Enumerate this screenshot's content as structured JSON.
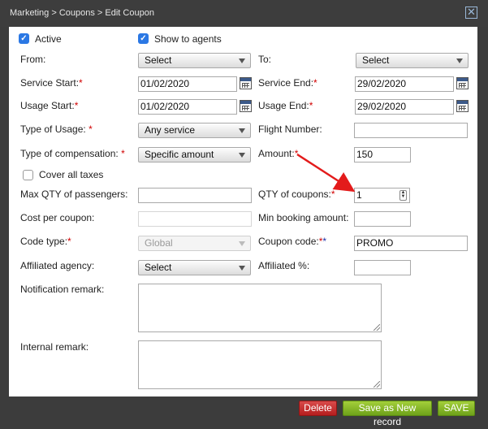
{
  "window": {
    "breadcrumb": "Marketing > Coupons > Edit Coupon",
    "close_glyph": "✕"
  },
  "form": {
    "active": {
      "label": "Active",
      "checked": true
    },
    "show_to_agents": {
      "label": "Show to agents",
      "checked": true
    },
    "from": {
      "label": "From:",
      "value": "Select"
    },
    "to": {
      "label": "To:",
      "value": "Select"
    },
    "service_start": {
      "label": "Service Start:",
      "required": "*",
      "value": "01/02/2020"
    },
    "service_end": {
      "label": "Service End:",
      "required": "*",
      "value": "29/02/2020"
    },
    "usage_start": {
      "label": "Usage Start:",
      "required": "*",
      "value": "01/02/2020"
    },
    "usage_end": {
      "label": "Usage End:",
      "required": "*",
      "value": "29/02/2020"
    },
    "type_of_usage": {
      "label": "Type of Usage:",
      "required": "*",
      "value": "Any service"
    },
    "flight_number": {
      "label": "Flight Number:",
      "value": ""
    },
    "type_of_compensation": {
      "label": "Type of compensation:",
      "required": "*",
      "value": "Specific amount"
    },
    "amount": {
      "label": "Amount:",
      "required": "*",
      "value": "150"
    },
    "cover_all_taxes": {
      "label": "Cover all taxes",
      "checked": false
    },
    "max_qty_passengers": {
      "label": "Max QTY of passengers:",
      "value": ""
    },
    "qty_of_coupons": {
      "label": "QTY of coupons:",
      "required": "*",
      "value": "1"
    },
    "cost_per_coupon": {
      "label": "Cost per coupon:",
      "value": ""
    },
    "min_booking_amount": {
      "label": "Min booking amount:",
      "value": ""
    },
    "code_type": {
      "label": "Code type:",
      "required": "*",
      "value": "Global"
    },
    "coupon_code": {
      "label": "Coupon code:",
      "required_red": "*",
      "required_blue": "*",
      "value": "PROMO"
    },
    "affiliated_agency": {
      "label": "Affiliated agency:",
      "value": "Select"
    },
    "affiliated_pct": {
      "label": "Affiliated %:",
      "value": ""
    },
    "notification_remark": {
      "label": "Notification remark:",
      "value": ""
    },
    "internal_remark": {
      "label": "Internal remark:",
      "value": ""
    }
  },
  "buttons": {
    "delete": "Delete",
    "save_as_new": "Save as New record",
    "save": "SAVE"
  },
  "colors": {
    "annotation_arrow": "#e31b1b",
    "checkbox": "#2b78e4",
    "required": "#d10000"
  }
}
